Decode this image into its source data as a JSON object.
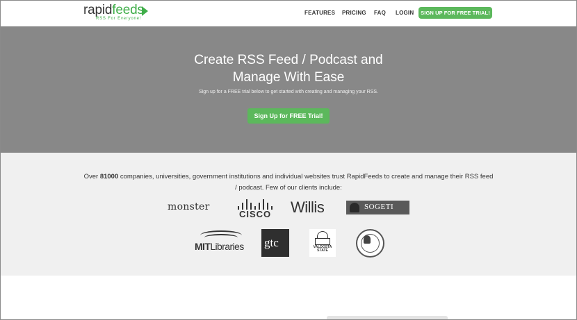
{
  "header": {
    "logo": {
      "brand_dark": "rapid",
      "brand_green": "feeds",
      "tagline": "RSS For Everyone!"
    },
    "nav": [
      {
        "label": "FEATURES"
      },
      {
        "label": "PRICING"
      },
      {
        "label": "FAQ"
      },
      {
        "label": "LOGIN"
      }
    ],
    "cta_label": "SIGN UP FOR FREE TRIAL!"
  },
  "hero": {
    "title_line1": "Create RSS Feed / Podcast and",
    "title_line2": "Manage With Ease",
    "subtitle": "Sign up for a FREE trial below to get started with creating and managing your RSS.",
    "button_label": "Sign Up for FREE Trial!"
  },
  "clients": {
    "text_before": "Over ",
    "count": "81000",
    "text_after": " companies, universities, government institutions and individual websites trust RapidFeeds to create and manage their RSS feed / podcast. Few of our clients include:",
    "logos": {
      "monster": "monster",
      "cisco": "CISCO",
      "willis": "Willis",
      "sogeti": "SOGETI",
      "mit_bold": "MIT",
      "mit_rest": "Libraries",
      "gtc": "gtc",
      "valdosta_1": "VALDOSTA",
      "valdosta_2": "STATE"
    }
  },
  "colors": {
    "accent_green": "#5cb85c",
    "hero_bg": "#888888",
    "clients_bg": "#f0f0f0"
  }
}
